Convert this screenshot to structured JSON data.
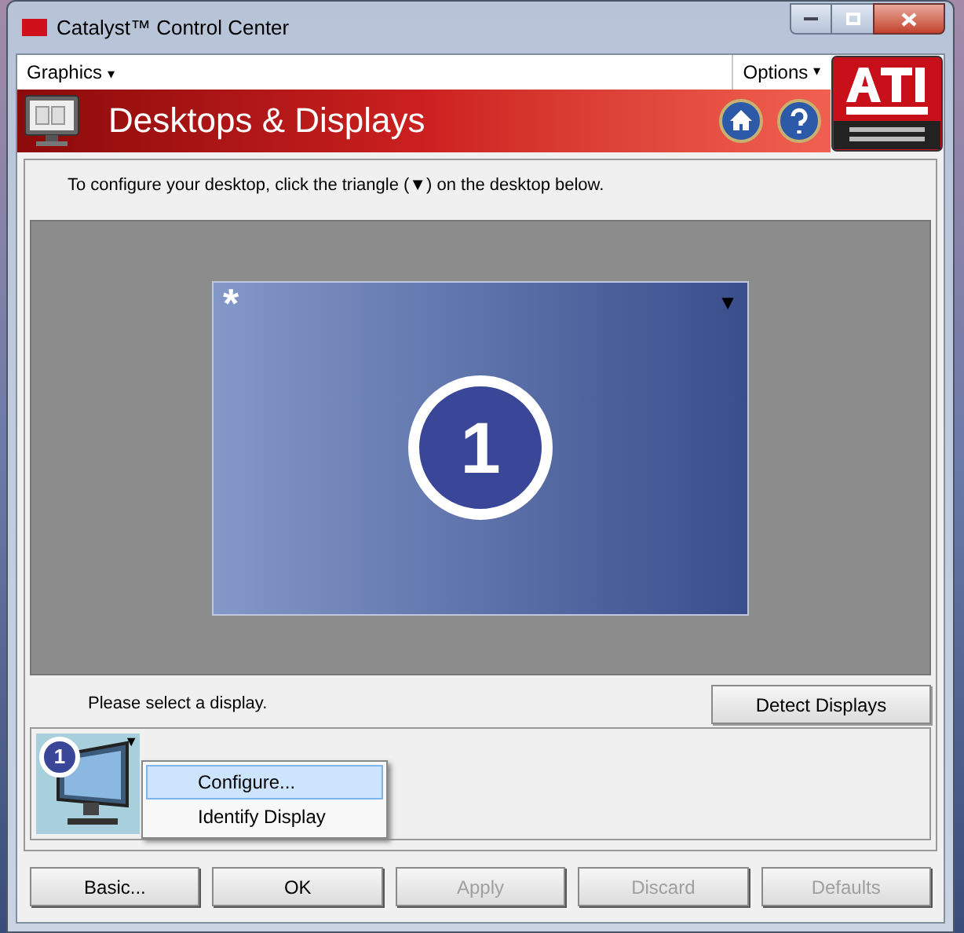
{
  "window": {
    "title": "Catalyst™ Control Center"
  },
  "menus": [
    {
      "label": "Graphics",
      "caret": "▾"
    },
    {
      "label": "Options",
      "caret": "▾"
    }
  ],
  "page_title": "Desktops & Displays",
  "instruction": "To configure your desktop, click the triangle (▼) on the desktop below.",
  "desktop": {
    "marker": "*",
    "number": "1",
    "menu_arrow": "▼"
  },
  "prompt": "Please select a display.",
  "detect_button": "Detect Displays",
  "displays": [
    {
      "number": "1",
      "menu_arrow": "▼"
    }
  ],
  "context_menu": [
    {
      "label": "Configure...",
      "selected": true
    },
    {
      "label": "Identify Display",
      "selected": false
    }
  ],
  "buttons": [
    {
      "label": "Basic...",
      "disabled": false
    },
    {
      "label": "OK",
      "disabled": false
    },
    {
      "label": "Apply",
      "disabled": true
    },
    {
      "label": "Discard",
      "disabled": true
    },
    {
      "label": "Defaults",
      "disabled": true
    }
  ]
}
